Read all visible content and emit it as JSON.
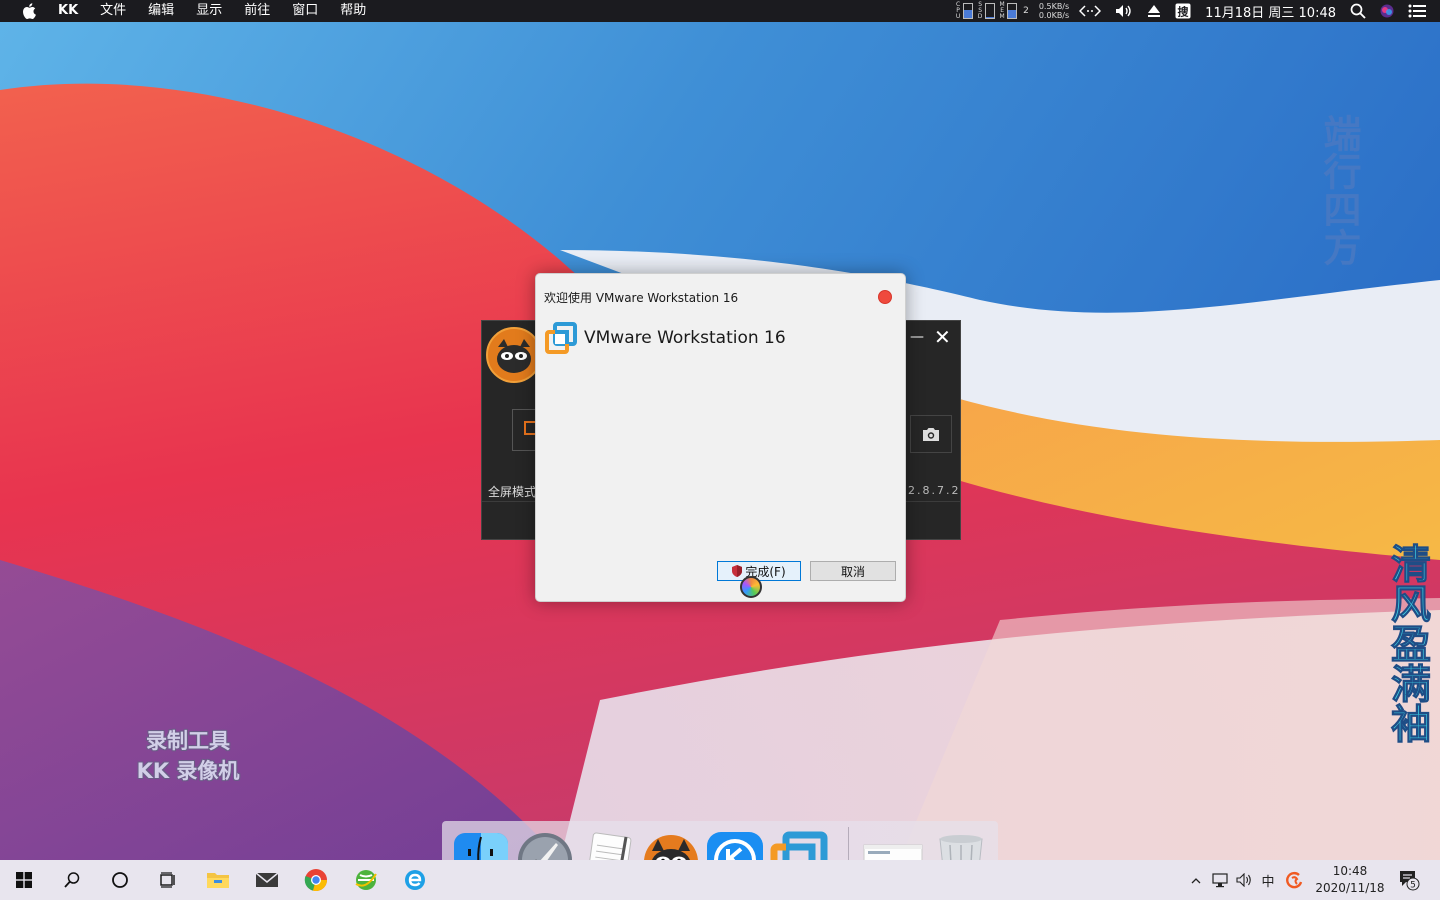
{
  "menubar": {
    "app_name": "KK",
    "menus": [
      "文件",
      "编辑",
      "显示",
      "前往",
      "窗口",
      "帮助"
    ],
    "meters": [
      {
        "label": "CPU",
        "level": 0.55
      },
      {
        "label": "SSD",
        "level": 0.1
      },
      {
        "label": "MEM",
        "level": 0.6
      }
    ],
    "meter_extra": "2",
    "net_up": "0.5KB/s",
    "net_down": "0.0KB/s",
    "datetime": "11月18日 周三 10:48"
  },
  "wallpaper_text": {
    "vertical_1": "端行四方",
    "vertical_2": "清风盈满袖",
    "watermark_line1": "录制工具",
    "watermark_line2": "KK 录像机"
  },
  "kk_window": {
    "mode_label": "全屏模式",
    "version": "2.8.7.2"
  },
  "dialog": {
    "title": "欢迎使用 VMware Workstation 16",
    "heading": "VMware Workstation 16",
    "finish_label": "完成(F)",
    "cancel_label": "取消"
  },
  "dock": {
    "apps": [
      "Finder",
      "Launchpad",
      "TextEdit",
      "KK录像机",
      "KK",
      "VMware Workstation",
      "Preview",
      "Trash"
    ]
  },
  "taskbar": {
    "time": "10:48",
    "date": "2020/11/18",
    "ime": "中",
    "notification_count": "5"
  },
  "colors": {
    "menubar_bg": "#1b1b1f",
    "dialog_bg": "#f1f1f1",
    "close_dot": "#ef4a3d",
    "finish_border": "#0078d7"
  }
}
